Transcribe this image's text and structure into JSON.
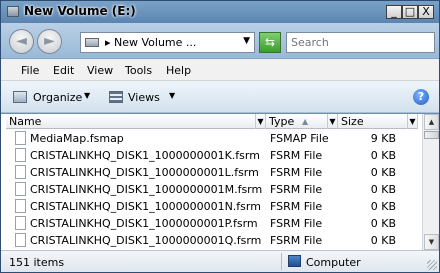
{
  "window": {
    "title": "New Volume (E:)",
    "controls": {
      "minimize": "_",
      "maximize": "□",
      "close": "X"
    }
  },
  "nav": {
    "back_glyph": "◄",
    "forward_glyph": "►",
    "address_text": "▸ New Volume ...",
    "address_dropdown": "▼",
    "refresh_glyph": "⇆",
    "search_placeholder": "Search"
  },
  "menubar": {
    "items": [
      "File",
      "Edit",
      "View",
      "Tools",
      "Help"
    ]
  },
  "toolbar": {
    "organize_label": "Organize",
    "views_label": "Views",
    "caret": "▼",
    "help_glyph": "?"
  },
  "columns": {
    "name": "Name",
    "type": "Type",
    "size": "Size",
    "drop_glyph": "▼",
    "sort_glyph": "▲"
  },
  "files": [
    {
      "name": "MediaMap.fsmap",
      "type": "FSMAP File",
      "size": "9 KB"
    },
    {
      "name": "CRISTALINKHQ_DISK1_1000000001K.fsrm",
      "type": "FSRM File",
      "size": "0 KB"
    },
    {
      "name": "CRISTALINKHQ_DISK1_1000000001L.fsrm",
      "type": "FSRM File",
      "size": "0 KB"
    },
    {
      "name": "CRISTALINKHQ_DISK1_1000000001M.fsrm",
      "type": "FSRM File",
      "size": "0 KB"
    },
    {
      "name": "CRISTALINKHQ_DISK1_1000000001N.fsrm",
      "type": "FSRM File",
      "size": "0 KB"
    },
    {
      "name": "CRISTALINKHQ_DISK1_1000000001P.fsrm",
      "type": "FSRM File",
      "size": "0 KB"
    },
    {
      "name": "CRISTALINKHQ_DISK1_1000000001Q.fsrm",
      "type": "FSRM File",
      "size": "0 KB"
    }
  ],
  "scrollbar": {
    "up_glyph": "▲",
    "down_glyph": "▼"
  },
  "statusbar": {
    "item_count": "151 items",
    "location": "Computer"
  }
}
